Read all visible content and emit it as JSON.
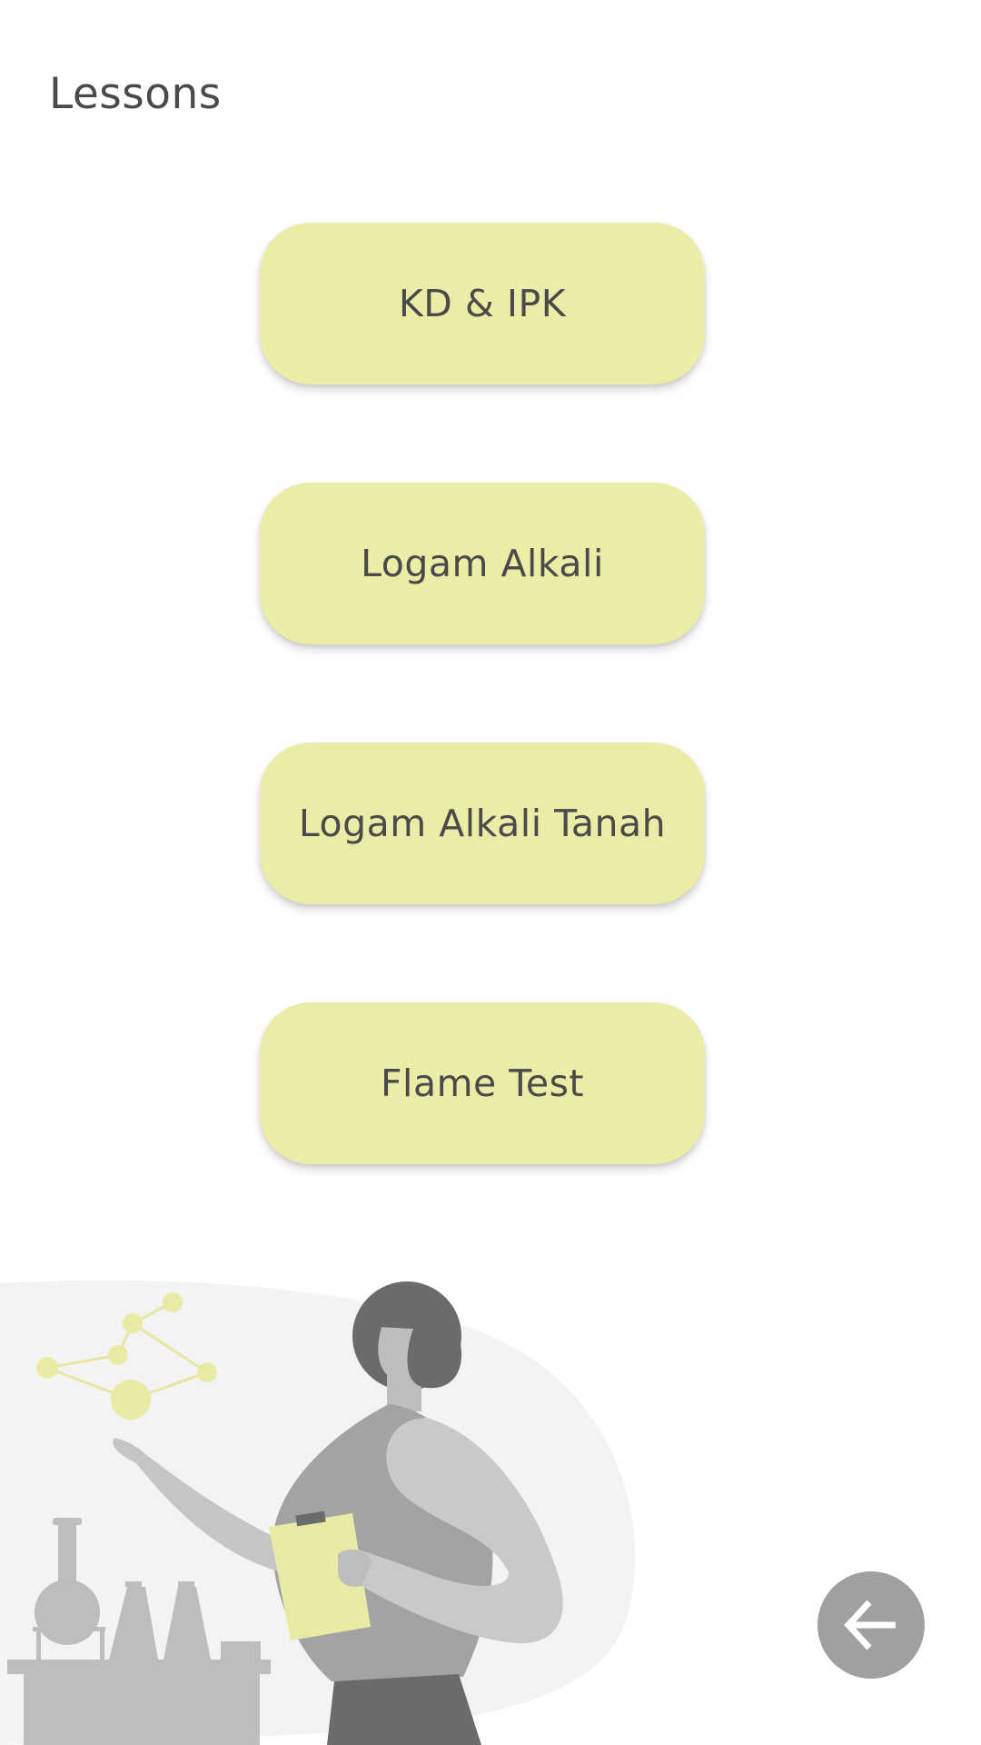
{
  "header": {
    "title": "Lessons"
  },
  "lessons": [
    {
      "label": "KD & IPK"
    },
    {
      "label": "Logam Alkali"
    },
    {
      "label": "Logam Alkali Tanah"
    },
    {
      "label": "Flame Test"
    }
  ],
  "colors": {
    "button_bg": "#ebeca6",
    "text": "#4a4a4a",
    "fab": "#a0a0a0",
    "accent_yellow": "#e9eba4"
  },
  "icons": {
    "back": "arrow-left-icon"
  }
}
